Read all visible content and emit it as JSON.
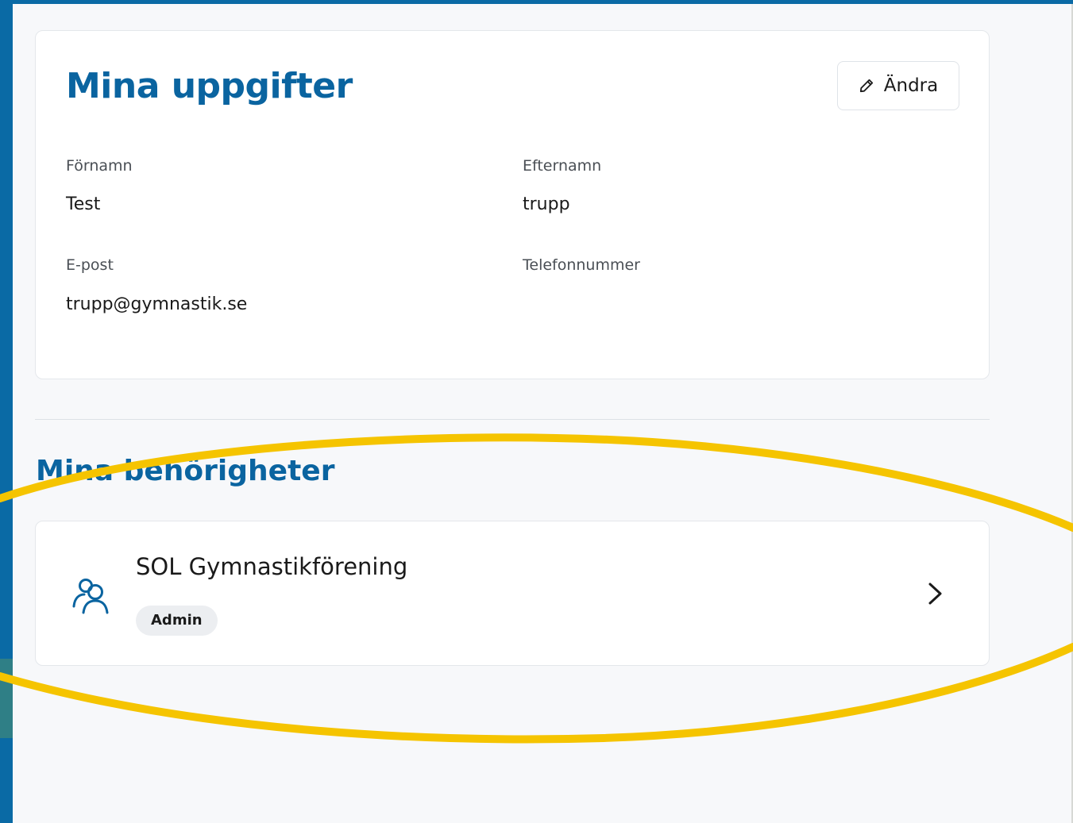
{
  "profile": {
    "title": "Mina uppgifter",
    "edit_label": "Ändra",
    "fields": [
      {
        "label": "Förnamn",
        "value": "Test"
      },
      {
        "label": "Efternamn",
        "value": "trupp"
      },
      {
        "label": "E-post",
        "value": "trupp@gymnastik.se"
      },
      {
        "label": "Telefonnummer",
        "value": ""
      }
    ]
  },
  "permissions": {
    "title": "Mina behörigheter",
    "items": [
      {
        "organization": "SOL Gymnastikförening",
        "role": "Admin",
        "icon": "users-icon"
      }
    ]
  },
  "colors": {
    "brand": "#0a64a0",
    "frame": "#0a6aa5",
    "highlight": "#f5c400",
    "background": "#f7f8fa"
  },
  "icons": {
    "edit": "pencil-icon",
    "group": "users-icon",
    "navigate": "chevron-right-icon"
  }
}
